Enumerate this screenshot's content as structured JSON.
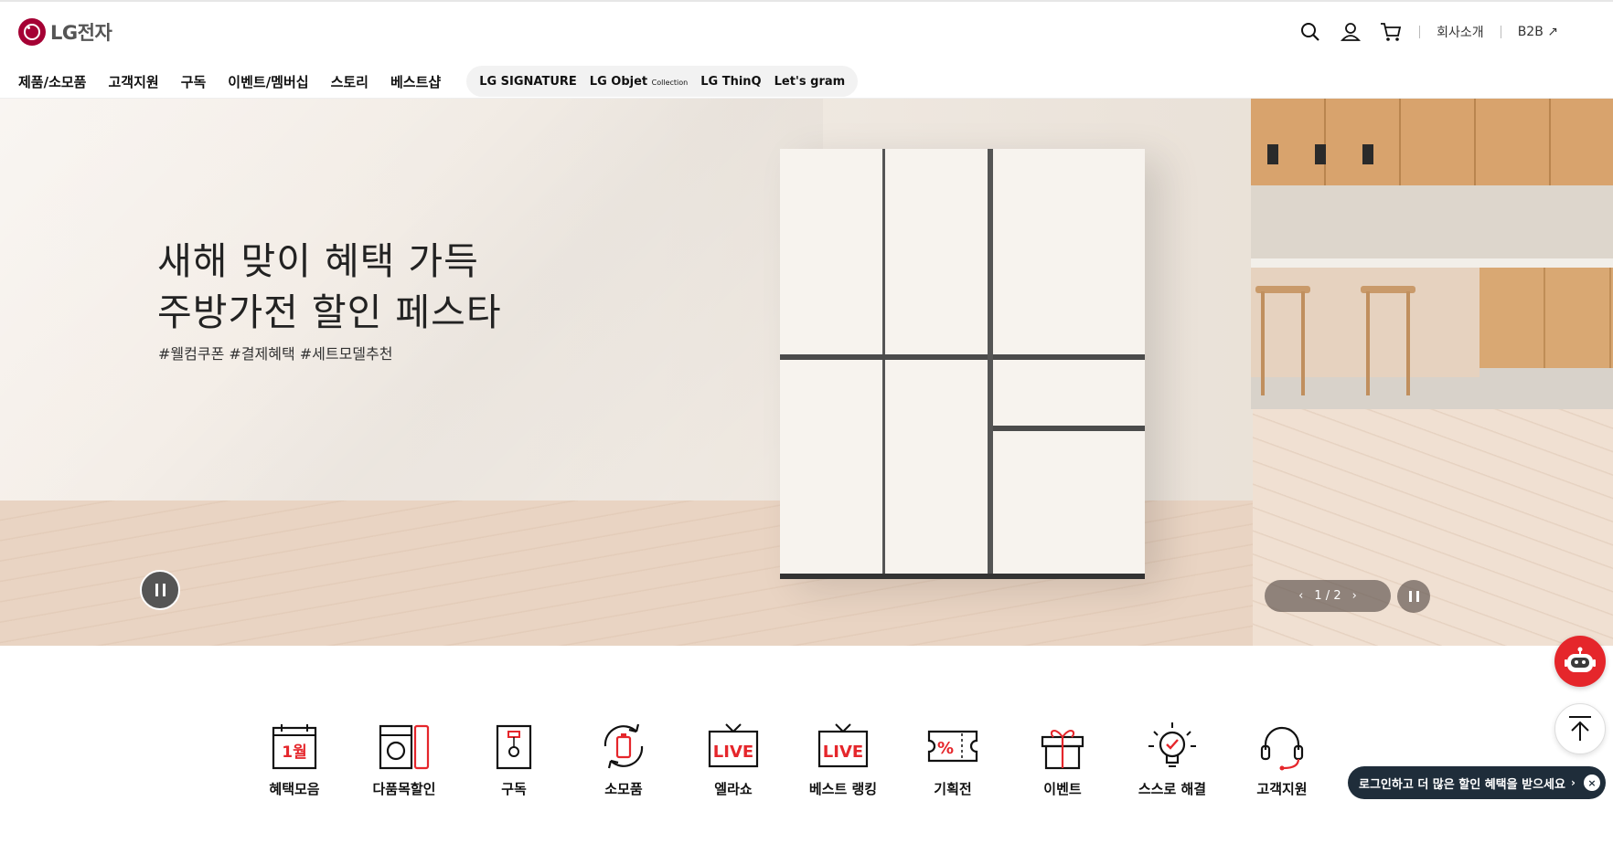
{
  "header": {
    "logo_text": "LG전자",
    "util_links": {
      "company": "회사소개",
      "b2b": "B2B ↗"
    },
    "nav": [
      "제품/소모품",
      "고객지원",
      "구독",
      "이벤트/멤버십",
      "스토리",
      "베스트샵"
    ],
    "brands": [
      "LG SIGNATURE",
      "LG Objet",
      "Collection",
      "LG ThinQ",
      "Let's gram"
    ]
  },
  "hero": {
    "title_line1": "새해 맞이 혜택 가득",
    "title_line2": "주방가전 할인 페스타",
    "tags": "#웰컴쿠폰 #결제혜택 #세트모델추천",
    "pager": {
      "prev": "‹",
      "current": "1",
      "divider": "/",
      "total": "2",
      "next": "›"
    }
  },
  "quick_menu": [
    {
      "label": "혜택모음",
      "icon": "calendar-icon",
      "badge": "1월"
    },
    {
      "label": "다품목할인",
      "icon": "appliances-icon"
    },
    {
      "label": "구독",
      "icon": "subscription-box-icon"
    },
    {
      "label": "소모품",
      "icon": "refresh-battery-icon"
    },
    {
      "label": "엘라쇼",
      "icon": "live-tv-icon",
      "badge": "LIVE"
    },
    {
      "label": "베스트 랭킹",
      "icon": "live-tv-icon",
      "badge": "LIVE"
    },
    {
      "label": "기획전",
      "icon": "coupon-icon",
      "badge": "%"
    },
    {
      "label": "이벤트",
      "icon": "gift-icon"
    },
    {
      "label": "스스로 해결",
      "icon": "lightbulb-icon"
    },
    {
      "label": "고객지원",
      "icon": "headset-icon"
    }
  ],
  "floating": {
    "login_banner": "로그인하고 더 많은 할인 혜택을 받으세요",
    "login_chevron": "›",
    "close": "×"
  },
  "colors": {
    "brand": "#a50034",
    "accent_red": "#e5262b",
    "banner_bg": "#1f2d3a"
  }
}
